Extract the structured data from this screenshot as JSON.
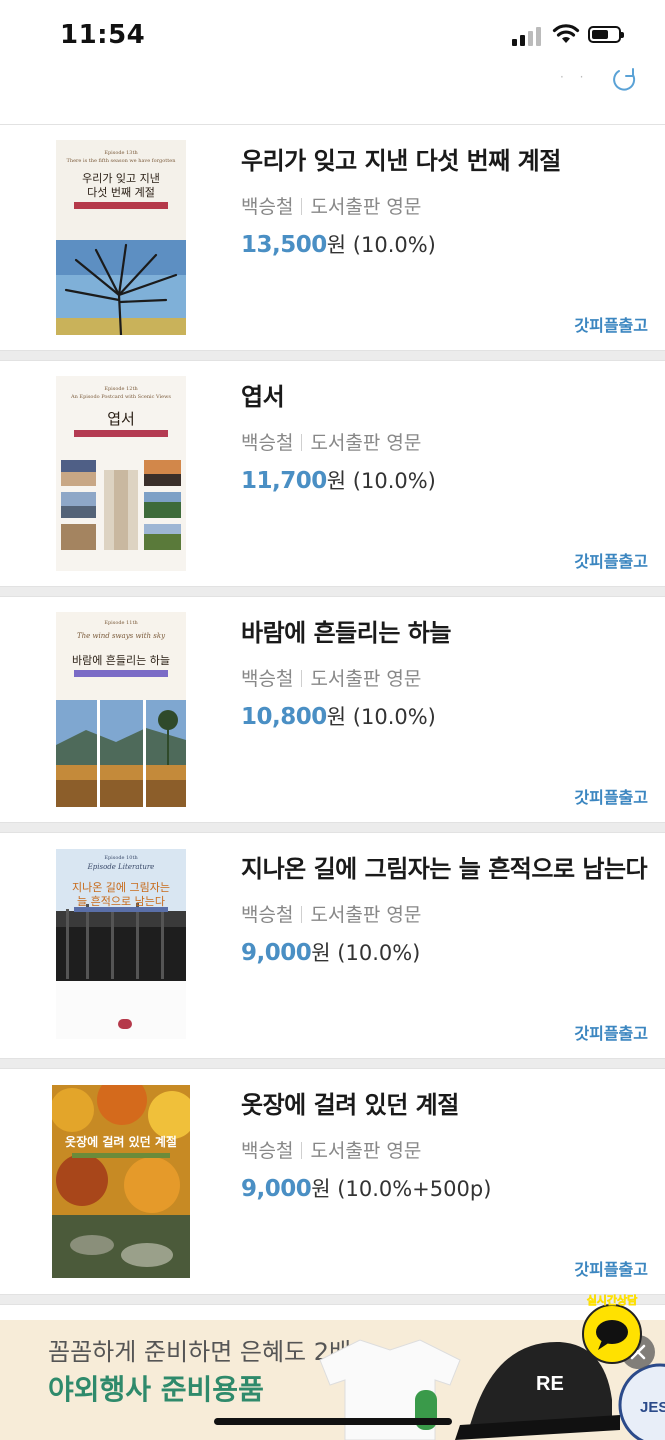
{
  "status": {
    "time": "11:54"
  },
  "books": [
    {
      "title": "우리가 잊고 지낸 다섯 번째 계절",
      "author": "백승철",
      "publisher": "도서출판 영문",
      "price": "13,500",
      "unit": "원",
      "discount": "(10.0%)",
      "shipping": "갓피플출고"
    },
    {
      "title": "엽서",
      "author": "백승철",
      "publisher": "도서출판 영문",
      "price": "11,700",
      "unit": "원",
      "discount": "(10.0%)",
      "shipping": "갓피플출고"
    },
    {
      "title": "바람에 흔들리는 하늘",
      "author": "백승철",
      "publisher": "도서출판 영문",
      "price": "10,800",
      "unit": "원",
      "discount": "(10.0%)",
      "shipping": "갓피플출고"
    },
    {
      "title": "지나온 길에 그림자는 늘 흔적으로 남는다",
      "author": "백승철",
      "publisher": "도서출판 영문",
      "price": "9,000",
      "unit": "원",
      "discount": "(10.0%)",
      "shipping": "갓피플출고"
    },
    {
      "title": "옷장에 걸려 있던 계절",
      "author": "백승철",
      "publisher": "도서출판 영문",
      "price": "9,000",
      "unit": "원",
      "discount": "(10.0%+500p)",
      "shipping": "갓피플출고"
    }
  ],
  "covers": [
    {
      "episode": "Episode 13th",
      "subtitle": "There is the fifth season we have forgotten",
      "line1": "우리가 잊고 지낸",
      "line2": "다섯 번째 계절"
    },
    {
      "episode": "Episode 12th",
      "subtitle": "An Episodo Postcard with Scenic Views",
      "line1": "엽서",
      "line2": ""
    },
    {
      "episode": "Episode 11th",
      "subtitle": "The wind sways with sky",
      "line1": "바람에 흔들리는 하늘",
      "line2": ""
    },
    {
      "episode": "Episode 10th",
      "subtitle": "Episode Literature",
      "line1": "지나온 길에 그림자는",
      "line2": "늘 흔적으로 남는다"
    },
    {
      "episode": "",
      "subtitle": "",
      "line1": "옷장에 걸려 있던 계절",
      "line2": ""
    }
  ],
  "banner": {
    "line1": "꼼꼼하게 준비하면 은혜도 2배",
    "line2": "야외행사 준비용품",
    "chat_label": "실시간상담",
    "cap_text": "RE",
    "badge_text": "JES"
  },
  "colors": {
    "accent": "#4a8fc4",
    "shipping": "#3b86c0",
    "banner_bg": "#f7ecd8",
    "banner_green": "#2f8a6b"
  }
}
